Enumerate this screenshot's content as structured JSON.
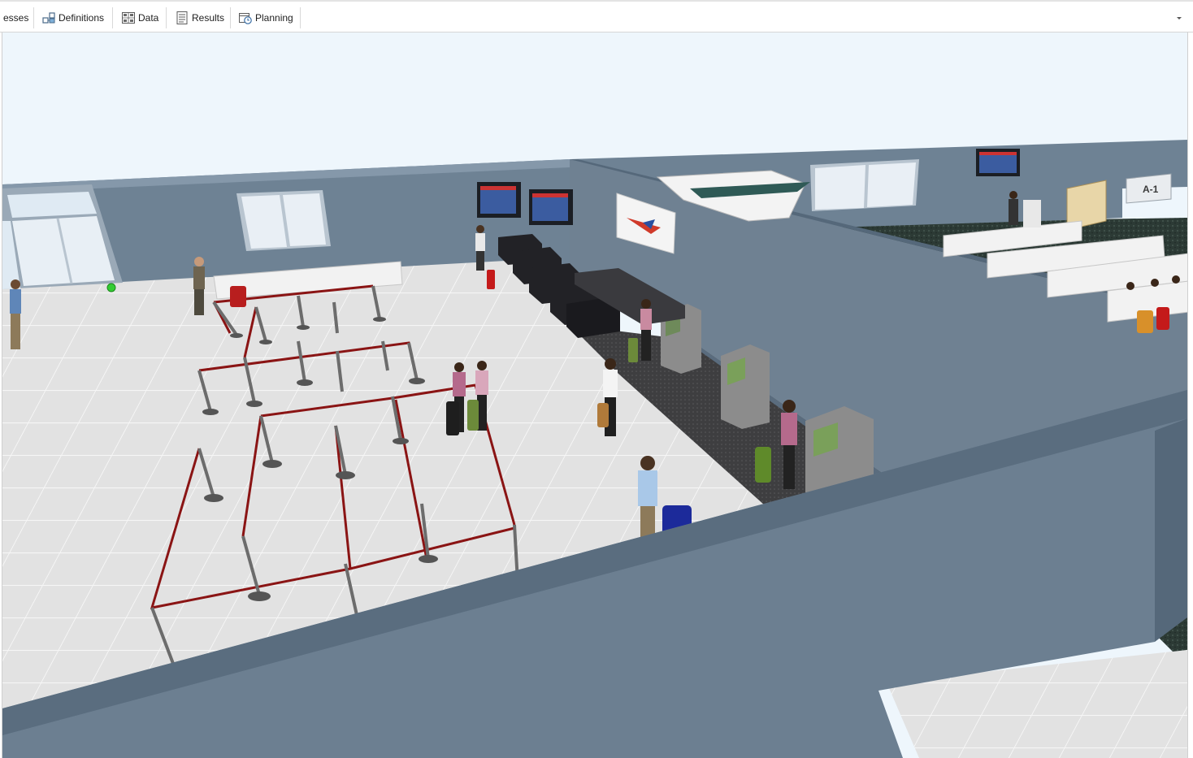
{
  "ribbon": {
    "tabs": [
      {
        "label": "esses",
        "icon": "processes-icon"
      },
      {
        "label": "Definitions",
        "icon": "definitions-icon"
      },
      {
        "label": "Data",
        "icon": "data-table-icon"
      },
      {
        "label": "Results",
        "icon": "results-list-icon"
      },
      {
        "label": "Planning",
        "icon": "planning-clock-icon"
      }
    ],
    "expand_icon": "chevron-down-icon"
  },
  "scene": {
    "gate_sign": "A-1",
    "colors": {
      "sky": "#eef6fc",
      "wall": "#6e8294",
      "floor": "#e1e1e1",
      "carpet": "#2c3a35",
      "stanchion_rope": "#8a1414"
    }
  }
}
